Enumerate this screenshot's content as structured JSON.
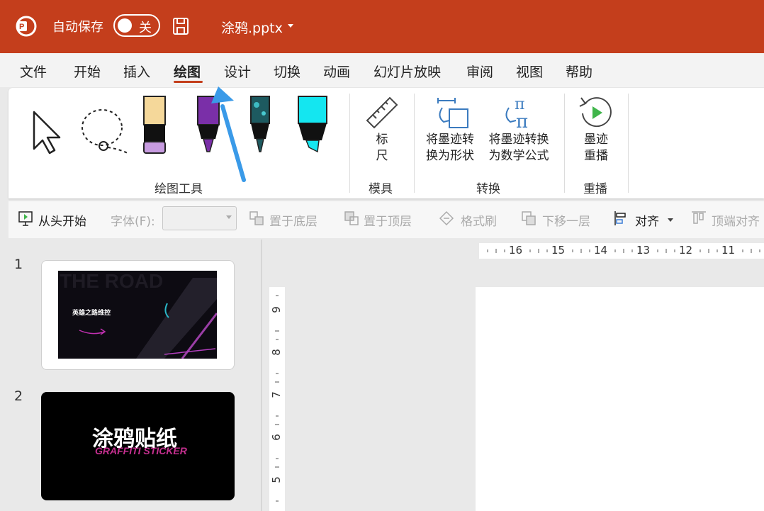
{
  "titlebar": {
    "autosave_label": "自动保存",
    "toggle_state": "关",
    "filename": "涂鸦.pptx"
  },
  "menu": {
    "tabs": [
      {
        "label": "文件"
      },
      {
        "label": "开始"
      },
      {
        "label": "插入"
      },
      {
        "label": "绘图",
        "active": true
      },
      {
        "label": "设计"
      },
      {
        "label": "切换"
      },
      {
        "label": "动画"
      },
      {
        "label": "幻灯片放映"
      },
      {
        "label": "审阅"
      },
      {
        "label": "视图"
      },
      {
        "label": "帮助"
      }
    ]
  },
  "ribbon": {
    "drawing_tools": {
      "group_label": "绘图工具",
      "tools": [
        "select-arrow-icon",
        "lasso-select-icon",
        "pen-light-purple",
        "pen-purple",
        "pen-teal-galaxy",
        "highlighter-cyan"
      ]
    },
    "stencils": {
      "group_label": "模具",
      "ruler_label": "标\n尺"
    },
    "convert": {
      "group_label": "转换",
      "ink_to_shape": "将墨迹转\n换为形状",
      "ink_to_math": "将墨迹转换\n为数学公式"
    },
    "replay": {
      "group_label": "重播",
      "ink_replay": "墨迹\n重播"
    }
  },
  "quickbar": {
    "from_start": "从头开始",
    "font_label": "字体(F):",
    "send_to_back": "置于底层",
    "bring_to_front": "置于顶层",
    "format_painter": "格式刷",
    "send_backward": "下移一层",
    "align": "对齐",
    "align_top": "顶端对齐"
  },
  "slides": {
    "items": [
      {
        "number": "1",
        "title": "英雄之路维控"
      },
      {
        "number": "2",
        "title": "涂鸦贴纸",
        "subtitle": "GRAFFITI STICKER"
      }
    ]
  },
  "rulers": {
    "horizontal": [
      "16",
      "15",
      "14",
      "13",
      "12",
      "11"
    ],
    "vertical": [
      "9",
      "8",
      "7",
      "6",
      "5"
    ]
  },
  "colors": {
    "accent": "#c43e1c",
    "annotation_arrow": "#3a9ae8"
  }
}
